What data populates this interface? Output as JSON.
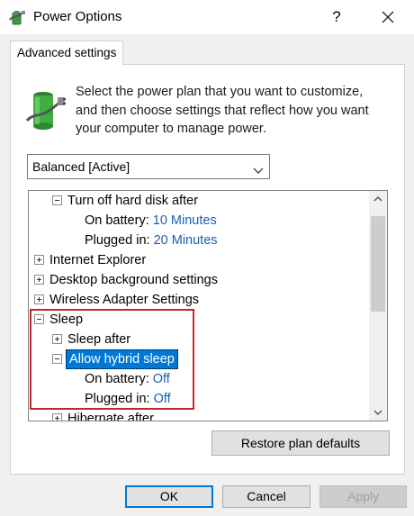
{
  "window": {
    "title": "Power Options",
    "help_label": "?",
    "close_icon": "close-icon"
  },
  "tab": {
    "label": "Advanced settings"
  },
  "header": {
    "icon": "battery-plug-icon",
    "line1": "Select the power plan that you want to customize,",
    "line2": "and then choose settings that reflect how you want",
    "line3": "your computer to manage power."
  },
  "plan_select": {
    "selected": "Balanced [Active]"
  },
  "tree": {
    "hard_disk": {
      "label": "Turn off hard disk after",
      "on_battery_label": "On battery:",
      "on_battery_value": "10 Minutes",
      "plugged_in_label": "Plugged in:",
      "plugged_in_value": "20 Minutes"
    },
    "internet_explorer": "Internet Explorer",
    "desktop_background": "Desktop background settings",
    "wireless_adapter": "Wireless Adapter Settings",
    "sleep": {
      "label": "Sleep",
      "sleep_after": "Sleep after",
      "hybrid": {
        "label": "Allow hybrid sleep",
        "on_battery_label": "On battery:",
        "on_battery_value": "Off",
        "plugged_in_label": "Plugged in:",
        "plugged_in_value": "Off"
      },
      "hibernate_after": "Hibernate after"
    }
  },
  "buttons": {
    "restore": "Restore plan defaults",
    "ok": "OK",
    "cancel": "Cancel",
    "apply": "Apply"
  },
  "colors": {
    "accent": "#0078d7",
    "value_text": "#1a5fb4",
    "highlight_box": "#c0272d"
  }
}
